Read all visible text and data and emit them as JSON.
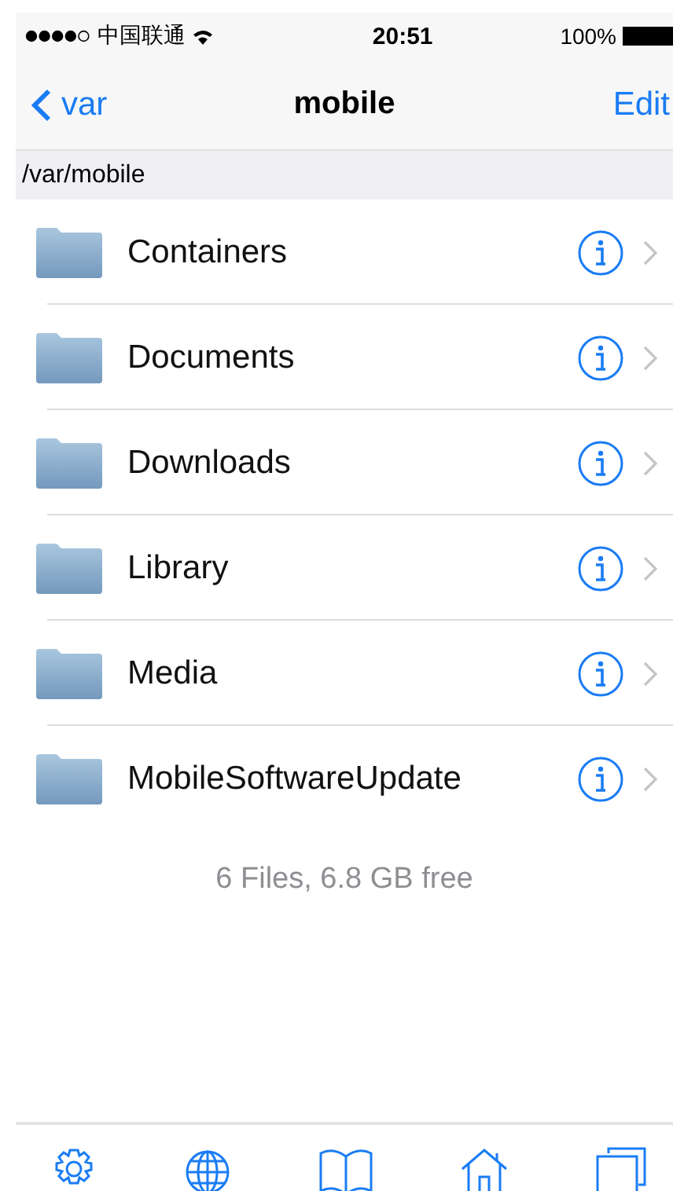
{
  "status_bar": {
    "carrier": "中国联通",
    "time": "20:51",
    "battery": "100%"
  },
  "nav": {
    "back": "var",
    "title": "mobile",
    "action": "Edit"
  },
  "path": "/var/mobile",
  "items": [
    {
      "name": "Containers"
    },
    {
      "name": "Documents"
    },
    {
      "name": "Downloads"
    },
    {
      "name": "Library"
    },
    {
      "name": "Media"
    },
    {
      "name": "MobileSoftwareUpdate"
    }
  ],
  "footer": "6 Files, 6.8 GB free"
}
